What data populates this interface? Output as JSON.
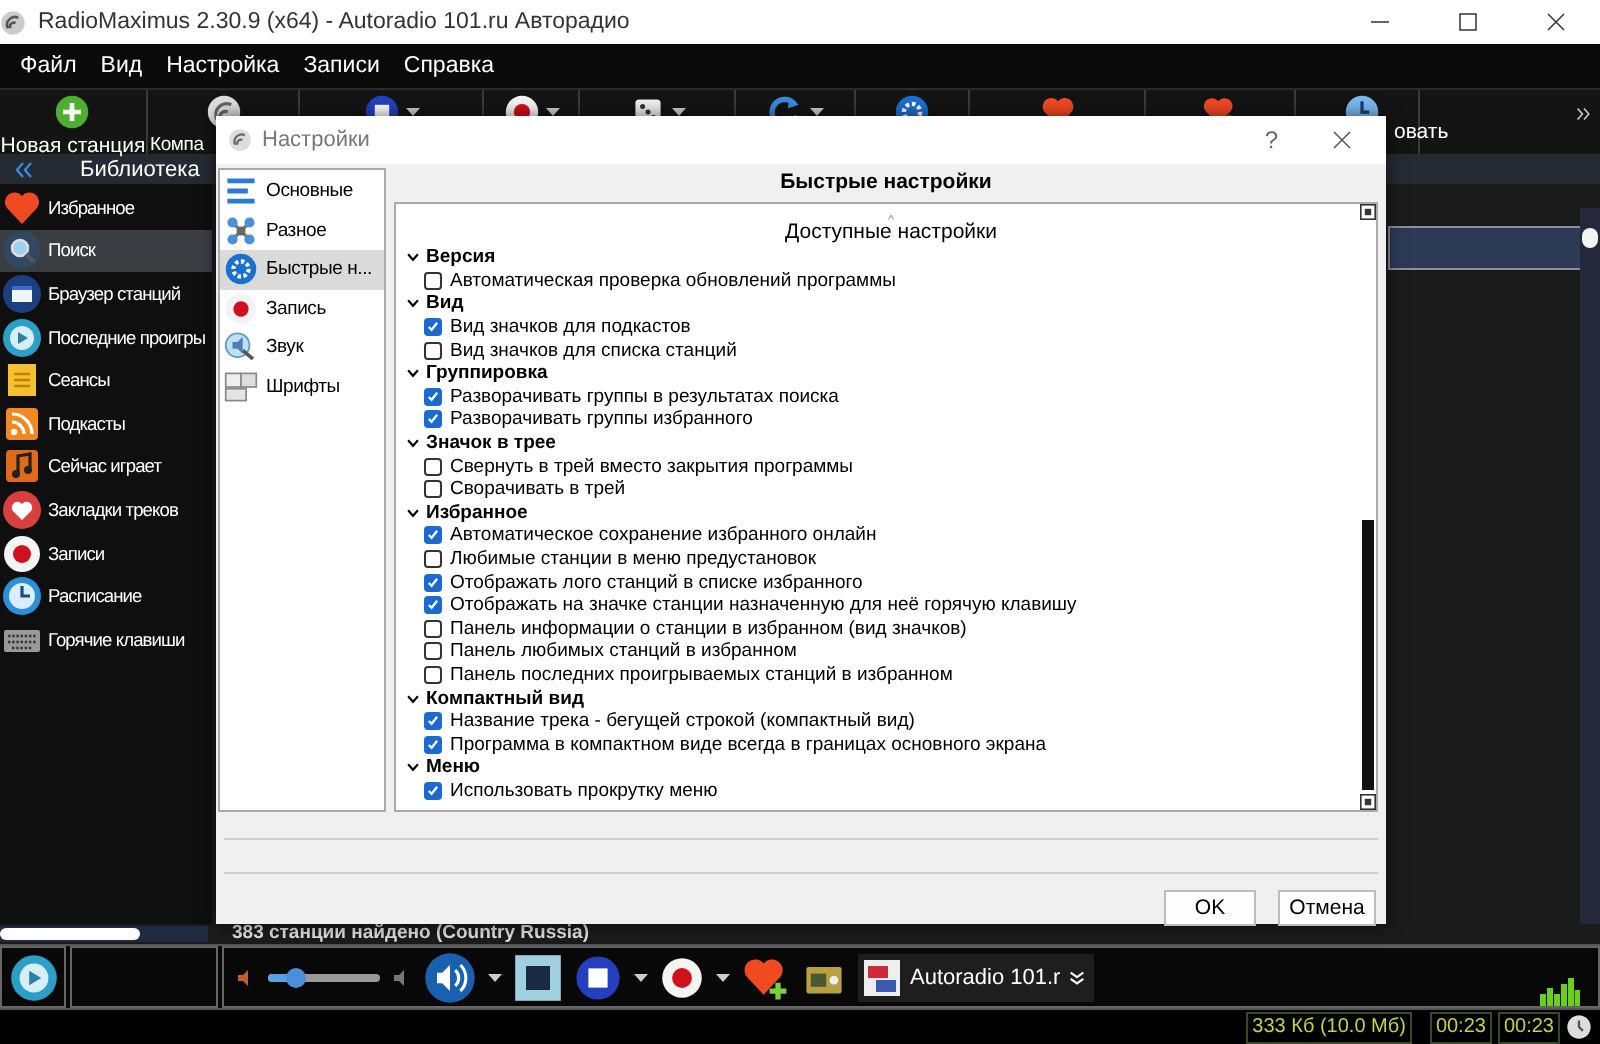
{
  "window": {
    "title": "RadioMaximus 2.30.9 (x64) - Autoradio 101.ru Авторадио"
  },
  "menu": [
    "Файл",
    "Вид",
    "Настройка",
    "Записи",
    "Справка"
  ],
  "toolbar": [
    {
      "kind": "add",
      "label": "Новая станция",
      "dropdown": false
    },
    {
      "kind": "radio",
      "label": "Компа",
      "dropdown": false
    },
    {
      "kind": "stop",
      "dropdown": true
    },
    {
      "kind": "record",
      "dropdown": true
    },
    {
      "kind": "dice",
      "dropdown": true
    },
    {
      "kind": "refresh",
      "dropdown": true
    },
    {
      "kind": "gear",
      "dropdown": false
    },
    {
      "kind": "heart",
      "dropdown": false
    },
    {
      "kind": "heart-add",
      "dropdown": false
    },
    {
      "kind": "clock",
      "label": "овать",
      "dropdown": false
    }
  ],
  "library": {
    "title": "Библиотека",
    "items": [
      {
        "kind": "heart",
        "label": "Избранное",
        "selected": false
      },
      {
        "kind": "search",
        "label": "Поиск",
        "selected": true
      },
      {
        "kind": "browser",
        "label": "Браузер станций",
        "selected": false
      },
      {
        "kind": "recent",
        "label": "Последние проигры",
        "selected": false
      },
      {
        "kind": "sessions",
        "label": "Сеансы",
        "selected": false
      },
      {
        "kind": "podcast",
        "label": "Подкасты",
        "selected": false
      },
      {
        "kind": "playing",
        "label": "Сейчас играет",
        "selected": false
      },
      {
        "kind": "bookmark",
        "label": "Закладки треков",
        "selected": false
      },
      {
        "kind": "record",
        "label": "Записи",
        "selected": false
      },
      {
        "kind": "schedule",
        "label": "Расписание",
        "selected": false
      },
      {
        "kind": "keyboard",
        "label": "Горячие клавиши",
        "selected": false
      }
    ]
  },
  "results_status": "383 станции найдено (Country Russia)",
  "dialog": {
    "title": "Настройки",
    "help": "?",
    "nav": [
      {
        "kind": "main",
        "label": "Основные",
        "selected": false
      },
      {
        "kind": "misc",
        "label": "Разное",
        "selected": false
      },
      {
        "kind": "quick",
        "label": "Быстрые н...",
        "selected": true
      },
      {
        "kind": "record",
        "label": "Запись",
        "selected": false
      },
      {
        "kind": "sound",
        "label": "Звук",
        "selected": false
      },
      {
        "kind": "fonts",
        "label": "Шрифты",
        "selected": false
      }
    ],
    "header": "Быстрые настройки",
    "panel_title": "Доступные настройки",
    "groups": [
      {
        "label": "Версия",
        "expanded": true,
        "children": [
          {
            "label": "Автоматическая проверка обновлений программы",
            "checked": false
          }
        ]
      },
      {
        "label": "Вид",
        "expanded": true,
        "children": [
          {
            "label": "Вид значков для подкастов",
            "checked": true
          },
          {
            "label": "Вид значков для списка станций",
            "checked": false
          }
        ]
      },
      {
        "label": "Группировка",
        "expanded": true,
        "children": [
          {
            "label": "Разворачивать группы в результатах поиска",
            "checked": true
          },
          {
            "label": "Разворачивать группы избранного",
            "checked": true
          }
        ]
      },
      {
        "label": "Значок в трее",
        "expanded": true,
        "children": [
          {
            "label": "Свернуть в трей вместо закрытия программы",
            "checked": false
          },
          {
            "label": "Сворачивать в трей",
            "checked": false
          }
        ]
      },
      {
        "label": "Избранное",
        "expanded": true,
        "children": [
          {
            "label": "Автоматическое сохранение избранного онлайн",
            "checked": true
          },
          {
            "label": "Любимые станции в меню предустановок",
            "checked": false
          },
          {
            "label": "Отображать лого станций в списке избранного",
            "checked": true
          },
          {
            "label": "Отображать на значке станции назначенную для неё горячую клавишу",
            "checked": true
          },
          {
            "label": "Панель информации о станции в избранном (вид значков)",
            "checked": false
          },
          {
            "label": "Панель любимых станций в избранном",
            "checked": false
          },
          {
            "label": "Панель последних проигрываемых станций в избранном",
            "checked": false
          }
        ]
      },
      {
        "label": "Компактный вид",
        "expanded": true,
        "children": [
          {
            "label": "Название трека - бегущей строкой (компактный вид)",
            "checked": true
          },
          {
            "label": "Программа в компактном виде всегда в границах основного экрана",
            "checked": true
          }
        ]
      },
      {
        "label": "Меню",
        "expanded": true,
        "children": [
          {
            "label": "Использовать прокрутку меню",
            "checked": true
          }
        ]
      }
    ],
    "buttons": [
      "OK",
      "Отмена"
    ]
  },
  "player": {
    "volume": {
      "level": 0.25
    },
    "station": "Autoradio 101.r"
  },
  "status_bar": {
    "traffic": "333 Кб (10.0 Мб)",
    "elapsed": "00:23",
    "duration": "00:23"
  }
}
